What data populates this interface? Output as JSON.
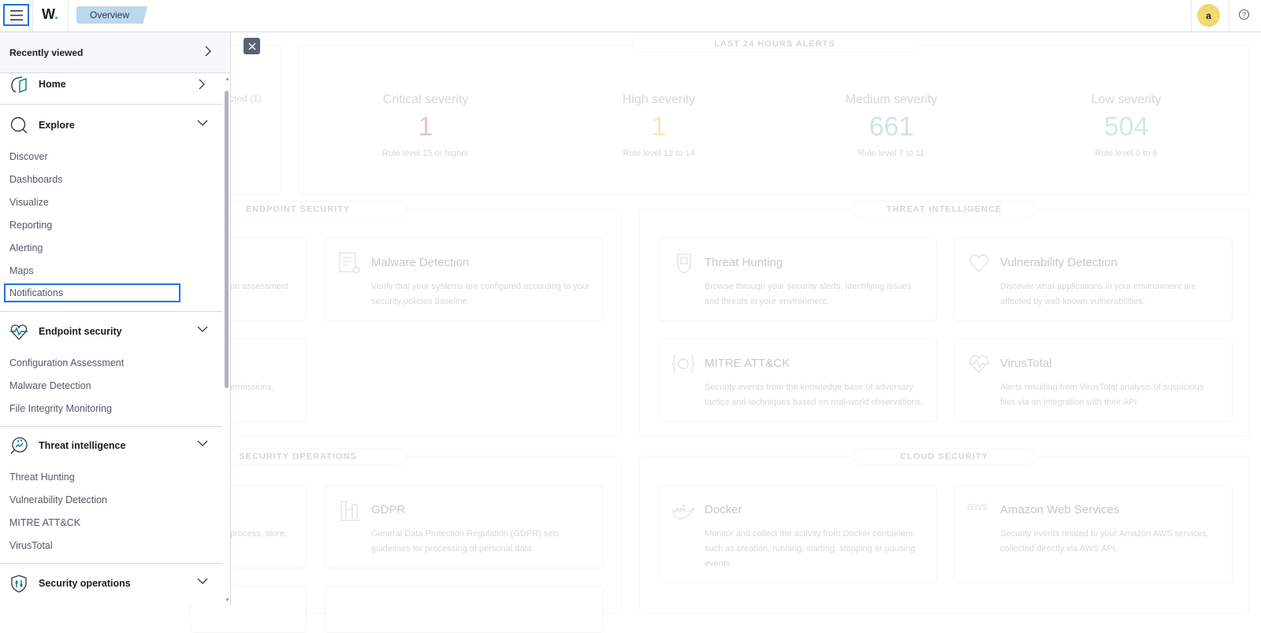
{
  "header": {
    "menu_icon": "hamburger-icon",
    "logo_text": "W",
    "logo_dot": ".",
    "breadcrumb": "Overview",
    "avatar_initial": "a",
    "help_icon": "?"
  },
  "sidebar": {
    "recently_viewed": "Recently viewed",
    "groups": [
      {
        "label": "Home",
        "icon": "home-icon",
        "expanded": false
      },
      {
        "label": "Explore",
        "icon": "search-icon",
        "expanded": true,
        "items": [
          "Discover",
          "Dashboards",
          "Visualize",
          "Reporting",
          "Alerting",
          "Maps",
          "Notifications"
        ]
      },
      {
        "label": "Endpoint security",
        "icon": "heart-pulse-icon",
        "expanded": true,
        "items": [
          "Configuration Assessment",
          "Malware Detection",
          "File Integrity Monitoring"
        ]
      },
      {
        "label": "Threat intelligence",
        "icon": "threat-intel-icon",
        "expanded": true,
        "items": [
          "Threat Hunting",
          "Vulnerability Detection",
          "MITRE ATT&CK",
          "VirusTotal"
        ]
      },
      {
        "label": "Security operations",
        "icon": "shield-icon",
        "expanded": false
      }
    ],
    "focused_item": "Notifications"
  },
  "main": {
    "agents_partial_text": "cted (1)",
    "alerts": {
      "title": "LAST 24 HOURS ALERTS",
      "items": [
        {
          "label": "Critical severity",
          "value": "1",
          "desc": "Rule level 15 or higher",
          "color": "#bd271e"
        },
        {
          "label": "High severity",
          "value": "1",
          "desc": "Rule level 12 to 14",
          "color": "#f5a700"
        },
        {
          "label": "Medium severity",
          "value": "661",
          "desc": "Rule level 7 to 11",
          "color": "#6092c0"
        },
        {
          "label": "Low severity",
          "value": "504",
          "desc": "Rule level 0 to 6",
          "color": "#54b399"
        }
      ]
    },
    "sections": {
      "endpoint_security": {
        "title": "ENDPOINT SECURITY",
        "partial_texts": [
          "on assessment",
          "ermissions,"
        ],
        "cards": [
          {
            "title": "Malware Detection",
            "desc": "Verify that your systems are configured according to your security policies baseline.",
            "icon": "document-gear-icon"
          }
        ]
      },
      "threat_intelligence": {
        "title": "THREAT INTELLIGENCE",
        "cards": [
          {
            "title": "Threat Hunting",
            "desc": "Browse through your security alerts, identifying issues and threats in your environment.",
            "icon": "shield-hunt-icon"
          },
          {
            "title": "Vulnerability Detection",
            "desc": "Discover what applications in your environment are affected by well-known vulnerabilities.",
            "icon": "broken-heart-icon"
          },
          {
            "title": "MITRE ATT&CK",
            "desc": "Security events from the knowledge base of adversary tactics and techniques based on real-world observations.",
            "icon": "target-braces-icon"
          },
          {
            "title": "VirusTotal",
            "desc": "Alerts resulting from VirusTotal analysis of suspicious files via an integration with their API.",
            "icon": "heart-pulse-icon"
          }
        ]
      },
      "security_operations": {
        "title": "SECURITY OPERATIONS",
        "partial_texts": [
          "process, store,"
        ],
        "cards": [
          {
            "title": "GDPR",
            "desc": "General Data Protection Regulation (GDPR) sets guidelines for processing of personal data.",
            "icon": "gdpr-icon"
          }
        ]
      },
      "cloud_security": {
        "title": "CLOUD SECURITY",
        "cards": [
          {
            "title": "Docker",
            "desc": "Monitor and collect the activity from Docker containers such as creation, running, starting, stopping or pausing events.",
            "icon": "docker-icon"
          },
          {
            "title": "Amazon Web Services",
            "desc": "Security events related to your Amazon AWS services, collected directly via AWS API.",
            "icon": "aws-icon"
          }
        ]
      }
    }
  }
}
